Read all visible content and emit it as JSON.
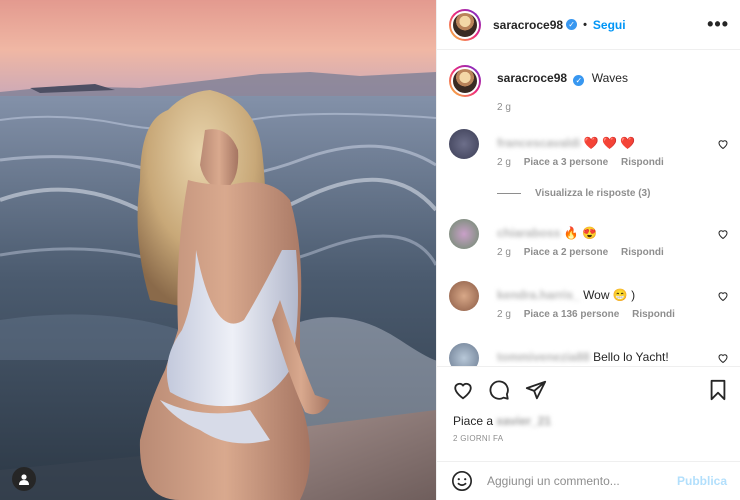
{
  "post": {
    "username": "saracroce98",
    "follow_label": "Segui",
    "more_label": "•••"
  },
  "caption": {
    "username": "saracroce98",
    "text": "Waves",
    "time": "2 g"
  },
  "comments": [
    {
      "user": "francescavaldi",
      "text": "❤️ ❤️ ❤️",
      "time": "2 g",
      "likes": "Piace a 3 persone",
      "reply": "Rispondi",
      "replies_label": "Visualizza le risposte (3)"
    },
    {
      "user": "chiaraboss",
      "text": "🔥 😍",
      "time": "2 g",
      "likes": "Piace a 2 persone",
      "reply": "Rispondi"
    },
    {
      "user": "kendra.harris_",
      "text": "Wow 😁 )",
      "time": "2 g",
      "likes": "Piace a 136 persone",
      "reply": "Rispondi"
    },
    {
      "user": "tommivenezia88",
      "text": "Bello lo Yacht!",
      "time": "",
      "likes": "",
      "reply": ""
    }
  ],
  "likes_prefix": "Piace a",
  "likes_user": "xavier_21",
  "date_label": "2 GIORNI FA",
  "add_comment": {
    "placeholder": "Aggiungi un commento...",
    "publish_label": "Pubblica"
  },
  "icons": {
    "verified": "verified-badge-icon",
    "like": "heart-icon",
    "comment": "comment-icon",
    "share": "paper-plane-icon",
    "save": "bookmark-icon",
    "emoji": "smiley-icon",
    "user_tag": "user-icon"
  },
  "colors": {
    "link_blue": "#0095f6",
    "publish_disabled": "#b2dffc",
    "muted_text": "#8e8e8e",
    "heart_red": "#ed4956"
  }
}
